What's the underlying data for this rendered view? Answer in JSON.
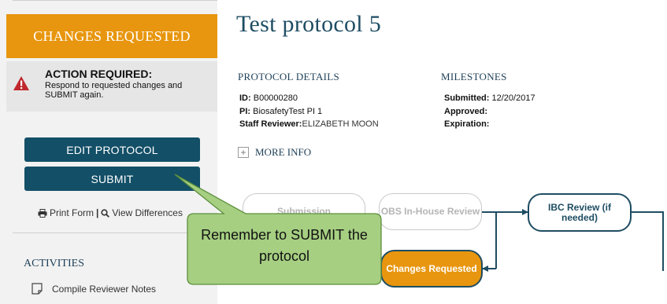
{
  "sidebar": {
    "status": "CHANGES REQUESTED",
    "action": {
      "title": "ACTION REQUIRED:",
      "message": "Respond to requested changes and SUBMIT again."
    },
    "buttons": {
      "edit": "EDIT PROTOCOL",
      "submit": "SUBMIT"
    },
    "links": {
      "print": "Print Form",
      "separator": "|",
      "diff": "View Differences"
    },
    "activities": {
      "title": "ACTIVITIES",
      "items": [
        "Compile Reviewer Notes"
      ]
    }
  },
  "main": {
    "title": "Test protocol 5",
    "details": {
      "heading": "PROTOCOL DETAILS",
      "id_label": "ID:",
      "id_value": "B00000280",
      "pi_label": "PI:",
      "pi_value": "BiosafetyTest PI 1",
      "reviewer_label": "Staff Reviewer:",
      "reviewer_value": "ELIZABETH MOON"
    },
    "milestones": {
      "heading": "MILESTONES",
      "submitted_label": "Submitted:",
      "submitted_value": "12/20/2017",
      "approved_label": "Approved:",
      "expiration_label": "Expiration:"
    },
    "more_info": "MORE INFO",
    "workflow": {
      "nodes": [
        {
          "label": "Submission",
          "state": "faded"
        },
        {
          "label": "OBS In-House Review",
          "state": "faded"
        },
        {
          "label": "IBC Review (if needed)",
          "state": "active"
        },
        {
          "label": "Changes Requested",
          "state": "current"
        }
      ]
    }
  },
  "callout": {
    "text": "Remember to SUBMIT the protocol"
  },
  "colors": {
    "brand_navy": "#134f67",
    "status_orange": "#e8960f",
    "callout_green": "#a6cf82",
    "warning_red": "#c0282d"
  }
}
